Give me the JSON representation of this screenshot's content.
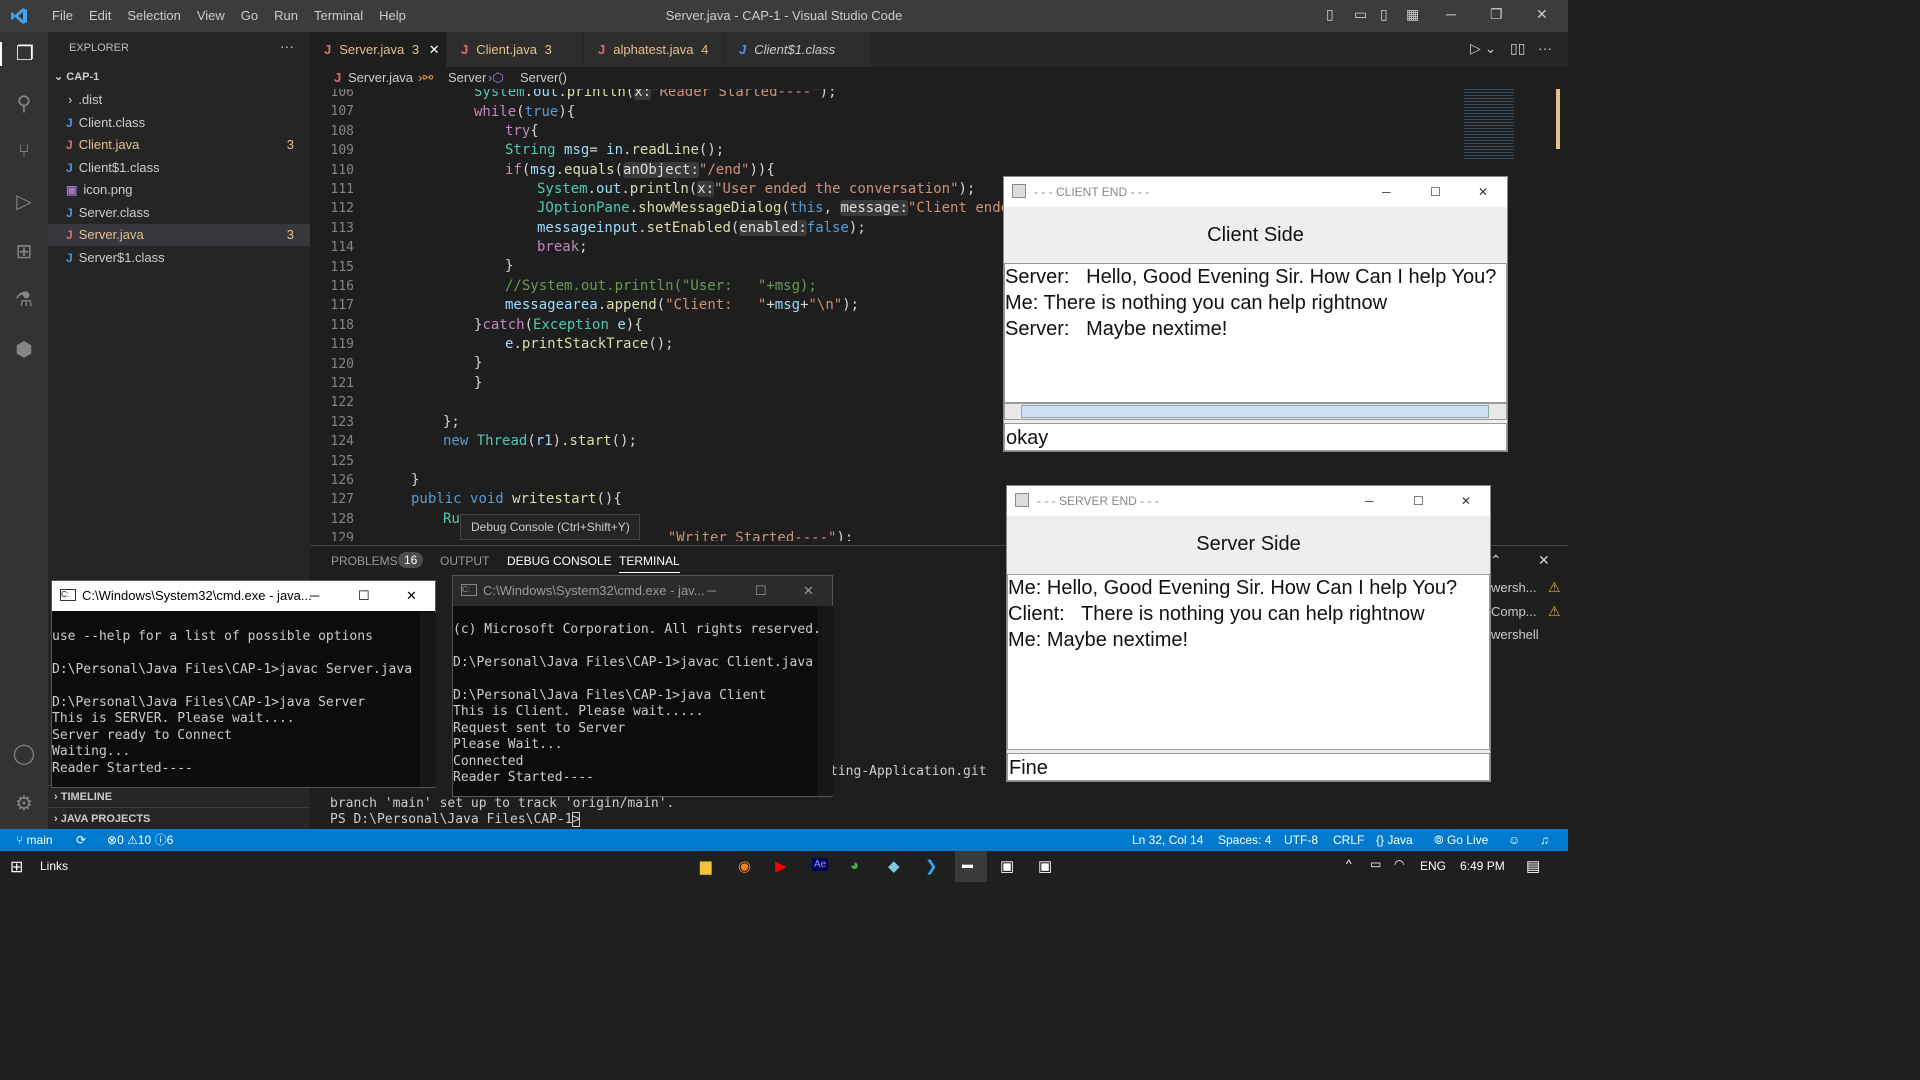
{
  "titlebar": {
    "menu": [
      "File",
      "Edit",
      "Selection",
      "View",
      "Go",
      "Run",
      "Terminal",
      "Help"
    ],
    "title": "Server.java - CAP-1 - Visual Studio Code"
  },
  "sidebar": {
    "header": "EXPLORER",
    "project": "CAP-1",
    "items": [
      {
        "label": ".dist",
        "badge": ""
      },
      {
        "label": "Client.class",
        "badge": ""
      },
      {
        "label": "Client.java",
        "badge": "3"
      },
      {
        "label": "Client$1.class",
        "badge": ""
      },
      {
        "label": "icon.png",
        "badge": ""
      },
      {
        "label": "Server.class",
        "badge": ""
      },
      {
        "label": "Server.java",
        "badge": "3"
      },
      {
        "label": "Server$1.class",
        "badge": ""
      }
    ],
    "timeline": "TIMELINE",
    "java_projects": "JAVA PROJECTS"
  },
  "tabs": [
    {
      "label": "Server.java",
      "badge": "3"
    },
    {
      "label": "Client.java",
      "badge": "3"
    },
    {
      "label": "alphatest.java",
      "badge": "4"
    },
    {
      "label": "Client$1.class",
      "badge": ""
    }
  ],
  "breadcrumb": {
    "file": "Server.java",
    "class": "Server",
    "method": "Server()"
  },
  "editor": {
    "line_numbers": [
      "106",
      "107",
      "108",
      "109",
      "110",
      "111",
      "112",
      "113",
      "114",
      "115",
      "116",
      "117",
      "118",
      "119",
      "120",
      "121",
      "122",
      "123",
      "124",
      "125",
      "126",
      "127",
      "128",
      "129"
    ]
  },
  "tooltip": "Debug Console (Ctrl+Shift+Y)",
  "panel": {
    "tabs": [
      "PROBLEMS",
      "OUTPUT",
      "DEBUG CONSOLE",
      "TERMINAL"
    ],
    "problems_count": "16",
    "terminal_lines": [
      "branch 'main' set up to track 'origin/main'.",
      "PS D:\\Personal\\Java Files\\CAP-1> "
    ],
    "git_fragment": "ting-Application.git",
    "right_items": [
      "wersh...",
      "Comp...",
      "wershell"
    ]
  },
  "cmd_server": {
    "title": "C:\\Windows\\System32\\cmd.exe - java...",
    "lines": [
      "use --help for a list of possible options",
      "",
      "D:\\Personal\\Java Files\\CAP-1>javac Server.java",
      "",
      "D:\\Personal\\Java Files\\CAP-1>java Server",
      "This is SERVER. Please wait....",
      "Server ready to Connect",
      "Waiting...",
      "Reader Started----"
    ]
  },
  "cmd_client": {
    "title": "C:\\Windows\\System32\\cmd.exe - jav...",
    "lines": [
      "(c) Microsoft Corporation. All rights reserved.",
      "",
      "D:\\Personal\\Java Files\\CAP-1>javac Client.java",
      "",
      "D:\\Personal\\Java Files\\CAP-1>java Client",
      "This is Client. Please wait.....",
      "Request sent to Server",
      "Please Wait...",
      "Connected",
      "Reader Started----"
    ]
  },
  "client_window": {
    "title": "- - - CLIENT END - - -",
    "header": "Client Side",
    "messages": "Server:   Hello, Good Evening Sir. How Can I help You?\nMe: There is nothing you can help rightnow\nServer:   Maybe nextime!",
    "input": "okay"
  },
  "server_window": {
    "title": "- - - SERVER END - - -",
    "header": "Server Side",
    "messages": "Me: Hello, Good Evening Sir. How Can I help You?\nClient:   There is nothing you can help rightnow\nMe: Maybe nextime!",
    "input": "Fine"
  },
  "status": {
    "branch": "main",
    "errors": "0",
    "warnings": "10",
    "info": "6",
    "position": "Ln 32, Col 14",
    "spaces": "Spaces: 4",
    "encoding": "UTF-8",
    "eol": "CRLF",
    "language": "Java",
    "golive": "Go Live"
  },
  "taskbar": {
    "links": "Links",
    "lang": "ENG",
    "time": "6:49 PM"
  },
  "colors": {
    "statusbar": "#007acc",
    "accent": "#0078d4"
  }
}
